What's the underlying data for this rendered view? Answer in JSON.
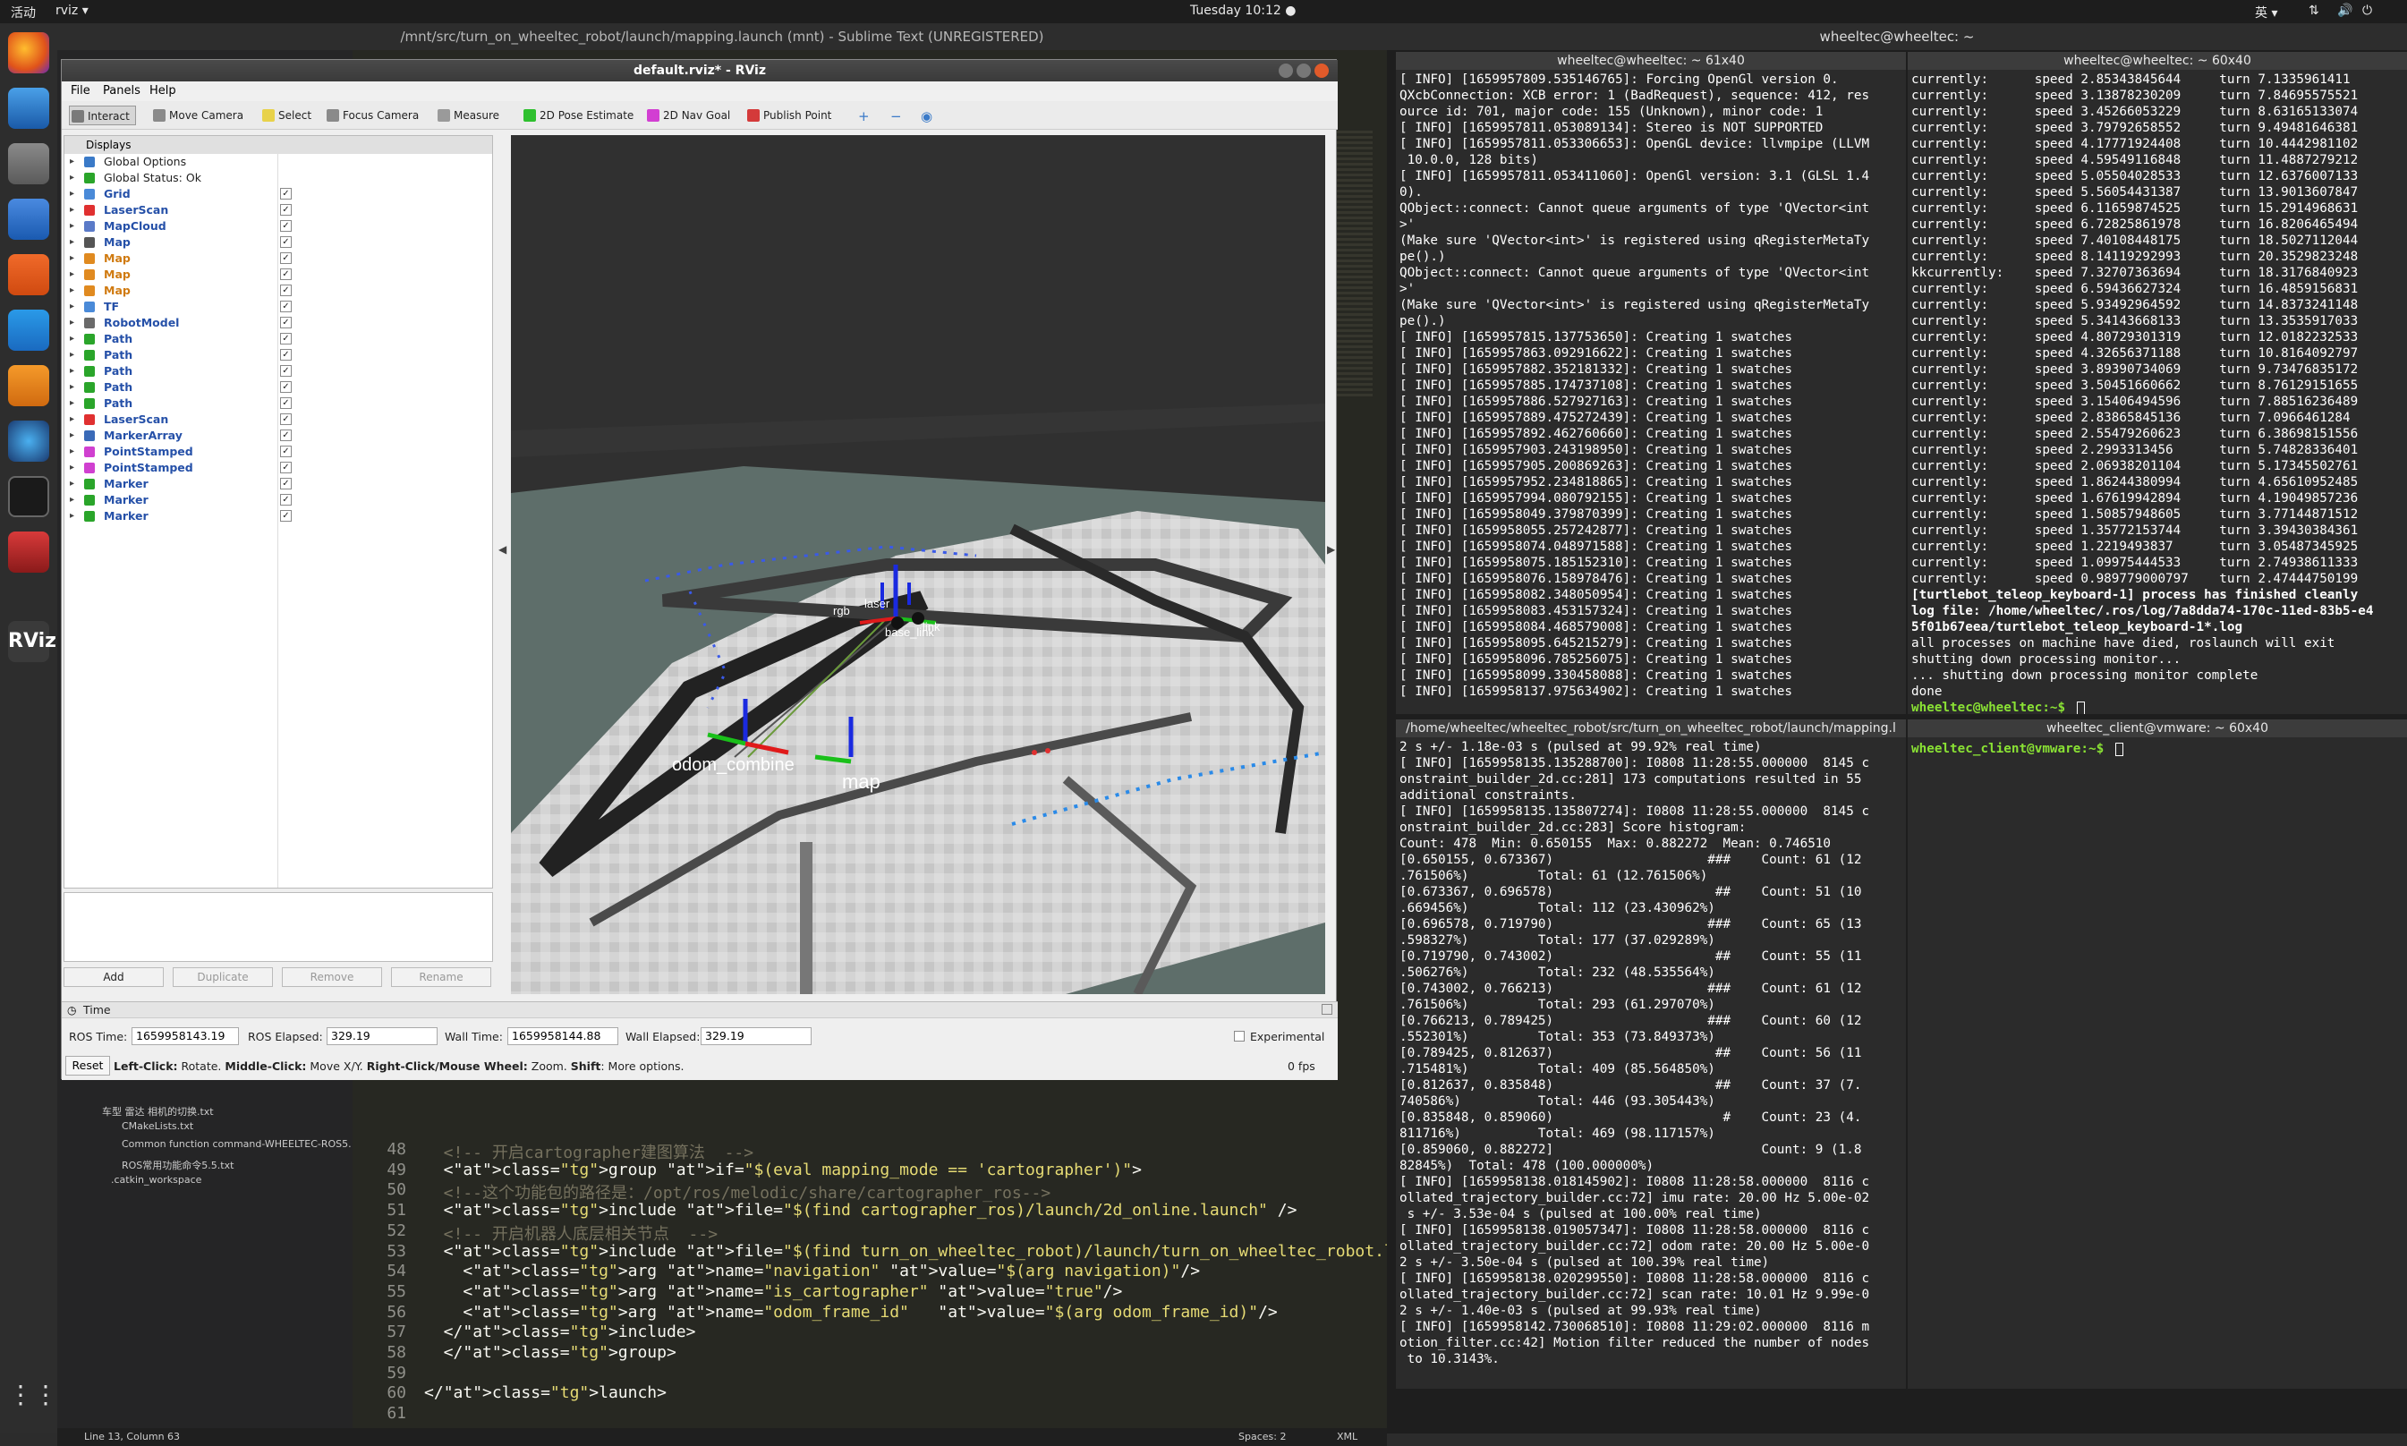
{
  "topbar": {
    "activities": "活动",
    "app": "rviz ▾",
    "clock": "Tuesday 10:12 ●",
    "lang": "英 ▾"
  },
  "sublime": {
    "title": "/mnt/src/turn_on_wheeltec_robot/launch/mapping.launch (mnt) - Sublime Text (UNREGISTERED)",
    "sidebar_items": [
      "车型 雷达 相机的切换.txt",
      "CMakeLists.txt",
      "Common function command-WHEELTEC-ROS5.",
      "ROS常用功能命令5.5.txt",
      ".catkin_workspace"
    ],
    "lines": [
      {
        "n": "48",
        "code": "  <!-- 开启cartographer建图算法  -->"
      },
      {
        "n": "49",
        "code": "  <group if=\"$(eval mapping_mode == 'cartographer')\">"
      },
      {
        "n": "50",
        "code": "  <!--这个功能包的路径是：/opt/ros/melodic/share/cartographer_ros-->"
      },
      {
        "n": "51",
        "code": "  <include file=\"$(find cartographer_ros)/launch/2d_online.launch\" />"
      },
      {
        "n": "52",
        "code": "  <!-- 开启机器人底层相关节点  -->"
      },
      {
        "n": "53",
        "code": "  <include file=\"$(find turn_on_wheeltec_robot)/launch/turn_on_wheeltec_robot.launch\">"
      },
      {
        "n": "54",
        "code": "    <arg name=\"navigation\" value=\"$(arg navigation)\"/>"
      },
      {
        "n": "55",
        "code": "    <arg name=\"is_cartographer\" value=\"true\"/>"
      },
      {
        "n": "56",
        "code": "    <arg name=\"odom_frame_id\"   value=\"$(arg odom_frame_id)\"/>"
      },
      {
        "n": "57",
        "code": "  </include>"
      },
      {
        "n": "58",
        "code": "  </group>"
      },
      {
        "n": "59",
        "code": ""
      },
      {
        "n": "60",
        "code": "</launch>"
      },
      {
        "n": "61",
        "code": ""
      }
    ],
    "status_left": "Line 13, Column 63",
    "status_spaces": "Spaces: 2",
    "status_syntax": "XML"
  },
  "rviz": {
    "title": "default.rviz* - RViz",
    "menu": [
      "File",
      "Panels",
      "Help"
    ],
    "tools": [
      {
        "label": "Interact",
        "color": "#7a7a7a"
      },
      {
        "label": "Move Camera",
        "color": "#8a8a8a"
      },
      {
        "label": "Select",
        "color": "#e8d24a"
      },
      {
        "label": "Focus Camera",
        "color": "#8a8a8a"
      },
      {
        "label": "Measure",
        "color": "#9a9a9a"
      },
      {
        "label": "2D Pose Estimate",
        "color": "#2ec02e"
      },
      {
        "label": "2D Nav Goal",
        "color": "#d23ed2"
      },
      {
        "label": "Publish Point",
        "color": "#d43a3a"
      }
    ],
    "displays_header": "Displays",
    "displays": [
      {
        "label": "Global Options",
        "color": "#3a7ac8",
        "checked": null,
        "plain": true
      },
      {
        "label": "Global Status: Ok",
        "color": "#2aa52a",
        "checked": null,
        "plain": true
      },
      {
        "label": "Grid",
        "color": "#4a8ad8",
        "checked": true
      },
      {
        "label": "LaserScan",
        "color": "#e03030",
        "checked": true
      },
      {
        "label": "MapCloud",
        "color": "#5a7ac8",
        "checked": true
      },
      {
        "label": "Map",
        "color": "#555",
        "checked": true
      },
      {
        "label": "Map",
        "color": "#e08a20",
        "checked": true,
        "orange": true
      },
      {
        "label": "Map",
        "color": "#e08a20",
        "checked": true,
        "orange": true
      },
      {
        "label": "Map",
        "color": "#e08a20",
        "checked": true,
        "orange": true
      },
      {
        "label": "TF",
        "color": "#4a8ad8",
        "checked": true
      },
      {
        "label": "RobotModel",
        "color": "#6a6a6a",
        "checked": true
      },
      {
        "label": "Path",
        "color": "#2aa52a",
        "checked": true
      },
      {
        "label": "Path",
        "color": "#2aa52a",
        "checked": true
      },
      {
        "label": "Path",
        "color": "#2aa52a",
        "checked": true
      },
      {
        "label": "Path",
        "color": "#2aa52a",
        "checked": true
      },
      {
        "label": "Path",
        "color": "#2aa52a",
        "checked": true
      },
      {
        "label": "LaserScan",
        "color": "#e03030",
        "checked": true
      },
      {
        "label": "MarkerArray",
        "color": "#3a6ab8",
        "checked": true
      },
      {
        "label": "PointStamped",
        "color": "#d040d0",
        "checked": true
      },
      {
        "label": "PointStamped",
        "color": "#d040d0",
        "checked": true
      },
      {
        "label": "Marker",
        "color": "#2aa52a",
        "checked": true
      },
      {
        "label": "Marker",
        "color": "#2aa52a",
        "checked": true
      },
      {
        "label": "Marker",
        "color": "#2aa52a",
        "checked": true
      }
    ],
    "buttons": [
      "Add",
      "Duplicate",
      "Remove",
      "Rename"
    ],
    "view_labels": {
      "odom": "odom_combine",
      "map": "map",
      "frames": [
        "rgb",
        "base_link",
        "laser",
        "link"
      ]
    },
    "time": {
      "header": "Time",
      "ros_time_label": "ROS Time:",
      "ros_time": "1659958143.19",
      "ros_elapsed_label": "ROS Elapsed:",
      "ros_elapsed": "329.19",
      "wall_time_label": "Wall Time:",
      "wall_time": "1659958144.88",
      "wall_elapsed_label": "Wall Elapsed:",
      "wall_elapsed": "329.19",
      "experimental": "Experimental",
      "reset": "Reset",
      "hint_a": "Left-Click:",
      "hint_b": " Rotate. ",
      "hint_c": "Middle-Click:",
      "hint_d": " Move X/Y. ",
      "hint_e": "Right-Click/Mouse Wheel:",
      "hint_f": " Zoom. ",
      "hint_g": "Shift",
      "hint_h": ": More options.",
      "fps": "0 fps"
    }
  },
  "terminal_window_title": "wheeltec@wheeltec: ~",
  "term1": {
    "title": "wheeltec@wheeltec: ~ 61x40",
    "lines": [
      "[ INFO] [1659957809.535146765]: Forcing OpenGl version 0.",
      "QXcbConnection: XCB error: 1 (BadRequest), sequence: 412, res",
      "ource id: 701, major code: 155 (Unknown), minor code: 1",
      "[ INFO] [1659957811.053089134]: Stereo is NOT SUPPORTED",
      "[ INFO] [1659957811.053306653]: OpenGL device: llvmpipe (LLVM",
      " 10.0.0, 128 bits)",
      "[ INFO] [1659957811.053411060]: OpenGl version: 3.1 (GLSL 1.4",
      "0).",
      "QObject::connect: Cannot queue arguments of type 'QVector<int",
      ">'",
      "(Make sure 'QVector<int>' is registered using qRegisterMetaTy",
      "pe().)",
      "QObject::connect: Cannot queue arguments of type 'QVector<int",
      ">'",
      "(Make sure 'QVector<int>' is registered using qRegisterMetaTy",
      "pe().)",
      "[ INFO] [1659957815.137753650]: Creating 1 swatches",
      "[ INFO] [1659957863.092916622]: Creating 1 swatches",
      "[ INFO] [1659957882.352181332]: Creating 1 swatches",
      "[ INFO] [1659957885.174737108]: Creating 1 swatches",
      "[ INFO] [1659957886.527927163]: Creating 1 swatches",
      "[ INFO] [1659957889.475272439]: Creating 1 swatches",
      "[ INFO] [1659957892.462760660]: Creating 1 swatches",
      "[ INFO] [1659957903.243198950]: Creating 1 swatches",
      "[ INFO] [1659957905.200869263]: Creating 1 swatches",
      "[ INFO] [1659957952.234818865]: Creating 1 swatches",
      "[ INFO] [1659957994.080792155]: Creating 1 swatches",
      "[ INFO] [1659958049.379870399]: Creating 1 swatches",
      "[ INFO] [1659958055.257242877]: Creating 1 swatches",
      "[ INFO] [1659958074.048971588]: Creating 1 swatches",
      "[ INFO] [1659958075.185152310]: Creating 1 swatches",
      "[ INFO] [1659958076.158978476]: Creating 1 swatches",
      "[ INFO] [1659958082.348050954]: Creating 1 swatches",
      "[ INFO] [1659958083.453157324]: Creating 1 swatches",
      "[ INFO] [1659958084.468579008]: Creating 1 swatches",
      "[ INFO] [1659958095.645215279]: Creating 1 swatches",
      "[ INFO] [1659958096.785256075]: Creating 1 swatches",
      "[ INFO] [1659958099.330458088]: Creating 1 swatches",
      "[ INFO] [1659958137.975634902]: Creating 1 swatches"
    ]
  },
  "term2": {
    "title": "wheeltec@wheeltec: ~ 60x40",
    "lines": [
      "currently:      speed 2.85343845644     turn 7.1335961411",
      "currently:      speed 3.13878230209     turn 7.84695575521",
      "currently:      speed 3.45266053229     turn 8.63165133074",
      "currently:      speed 3.79792658552     turn 9.49481646381",
      "currently:      speed 4.17771924408     turn 10.4442981102",
      "currently:      speed 4.59549116848     turn 11.4887279212",
      "currently:      speed 5.05504028533     turn 12.6376007133",
      "currently:      speed 5.56054431387     turn 13.9013607847",
      "currently:      speed 6.11659874525     turn 15.2914968631",
      "currently:      speed 6.72825861978     turn 16.8206465494",
      "currently:      speed 7.40108448175     turn 18.5027112044",
      "currently:      speed 8.14119292993     turn 20.3529823248",
      "kkcurrently:    speed 7.32707363694     turn 18.3176840923",
      "currently:      speed 6.59436627324     turn 16.4859156831",
      "currently:      speed 5.93492964592     turn 14.8373241148",
      "currently:      speed 5.34143668133     turn 13.3535917033",
      "currently:      speed 4.80729301319     turn 12.0182232533",
      "currently:      speed 4.32656371188     turn 10.8164092797",
      "currently:      speed 3.89390734069     turn 9.73476835172",
      "currently:      speed 3.50451660662     turn 8.76129151655",
      "currently:      speed 3.15406494596     turn 7.88516236489",
      "currently:      speed 2.83865845136     turn 7.0966461284",
      "currently:      speed 2.55479260623     turn 6.38698151556",
      "currently:      speed 2.2993313456      turn 5.74828336401",
      "currently:      speed 2.06938201104     turn 5.17345502761",
      "currently:      speed 1.86244380994     turn 4.65610952485",
      "currently:      speed 1.67619942894     turn 4.19049857236",
      "currently:      speed 1.50857948605     turn 3.77144871512",
      "currently:      speed 1.35772153744     turn 3.39430384361",
      "currently:      speed 1.2219493837      turn 3.05487345925",
      "currently:      speed 1.09975444533     turn 2.74938611333",
      "currently:      speed 0.989779000797    turn 2.47444750199",
      "[turtlebot_teleop_keyboard-1] process has finished cleanly",
      "log file: /home/wheeltec/.ros/log/7a8dda74-170c-11ed-83b5-e4",
      "5f01b67eea/turtlebot_teleop_keyboard-1*.log",
      "all processes on machine have died, roslaunch will exit",
      "shutting down processing monitor...",
      "... shutting down processing monitor complete",
      "done"
    ],
    "prompt": "wheeltec@wheeltec:~$ "
  },
  "term3": {
    "title": "/home/wheeltec/wheeltec_robot/src/turn_on_wheeltec_robot/launch/mapping.l",
    "lines": [
      "2 s +/- 1.18e-03 s (pulsed at 99.92% real time)",
      "[ INFO] [1659958135.135288700]: I0808 11:28:55.000000  8145 c",
      "onstraint_builder_2d.cc:281] 173 computations resulted in 55",
      "additional constraints.",
      "[ INFO] [1659958135.135807274]: I0808 11:28:55.000000  8145 c",
      "onstraint_builder_2d.cc:283] Score histogram:",
      "Count: 478  Min: 0.650155  Max: 0.882272  Mean: 0.746510",
      "[0.650155, 0.673367)                    ###    Count: 61 (12",
      ".761506%)         Total: 61 (12.761506%)",
      "[0.673367, 0.696578)                     ##    Count: 51 (10",
      ".669456%)         Total: 112 (23.430962%)",
      "[0.696578, 0.719790)                    ###    Count: 65 (13",
      ".598327%)         Total: 177 (37.029289%)",
      "[0.719790, 0.743002)                     ##    Count: 55 (11",
      ".506276%)         Total: 232 (48.535564%)",
      "[0.743002, 0.766213)                    ###    Count: 61 (12",
      ".761506%)         Total: 293 (61.297070%)",
      "[0.766213, 0.789425)                    ###    Count: 60 (12",
      ".552301%)         Total: 353 (73.849373%)",
      "[0.789425, 0.812637)                     ##    Count: 56 (11",
      ".715481%)         Total: 409 (85.564850%)",
      "[0.812637, 0.835848)                     ##    Count: 37 (7.",
      "740586%)          Total: 446 (93.305443%)",
      "[0.835848, 0.859060)                      #    Count: 23 (4.",
      "811716%)          Total: 469 (98.117157%)",
      "[0.859060, 0.882272]                           Count: 9 (1.8",
      "82845%)  Total: 478 (100.000000%)",
      "[ INFO] [1659958138.018145902]: I0808 11:28:58.000000  8116 c",
      "ollated_trajectory_builder.cc:72] imu rate: 20.00 Hz 5.00e-02",
      " s +/- 3.53e-04 s (pulsed at 100.00% real time)",
      "[ INFO] [1659958138.019057347]: I0808 11:28:58.000000  8116 c",
      "ollated_trajectory_builder.cc:72] odom rate: 20.00 Hz 5.00e-0",
      "2 s +/- 3.50e-04 s (pulsed at 100.39% real time)",
      "[ INFO] [1659958138.020299550]: I0808 11:28:58.000000  8116 c",
      "ollated_trajectory_builder.cc:72] scan rate: 10.01 Hz 9.99e-0",
      "2 s +/- 1.40e-03 s (pulsed at 99.93% real time)",
      "[ INFO] [1659958142.730068510]: I0808 11:29:02.000000  8116 m",
      "otion_filter.cc:42] Motion filter reduced the number of nodes",
      " to 10.3143%."
    ]
  },
  "term4": {
    "title": "wheeltec_client@vmware: ~ 60x40",
    "prompt": "wheeltec_client@vmware:~$ "
  }
}
